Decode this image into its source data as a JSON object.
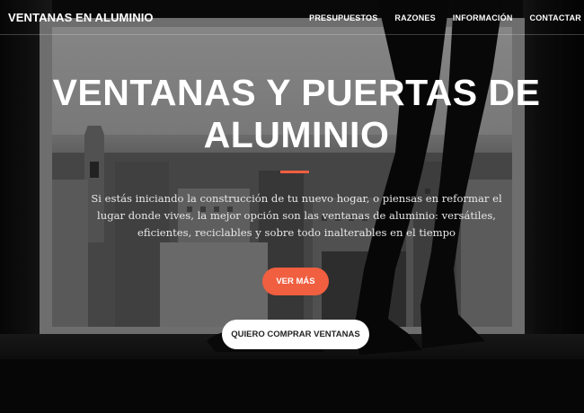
{
  "navbar": {
    "brand": "VENTANAS EN ALUMINIO",
    "links": [
      {
        "label": "PRESUPUESTOS"
      },
      {
        "label": "RAZONES"
      },
      {
        "label": "INFORMACIÓN"
      },
      {
        "label": "CONTACTAR"
      }
    ]
  },
  "hero": {
    "title": "VENTANAS Y PUERTAS DE ALUMINIO",
    "text": "Si estás iniciando la construcción de tu nuevo hogar, o piensas en reformar el lugar donde vives, la mejor opción son las ventanas de aluminio: versátiles, eficientes, reciclables y sobre todo inalterables en el tiempo",
    "primary_button": "VER MÁS",
    "secondary_button": "QUIERO COMPRAR VENTANAS"
  },
  "colors": {
    "accent": "#f05f40",
    "text_light": "#ffffff",
    "button_light": "#ffffff"
  }
}
